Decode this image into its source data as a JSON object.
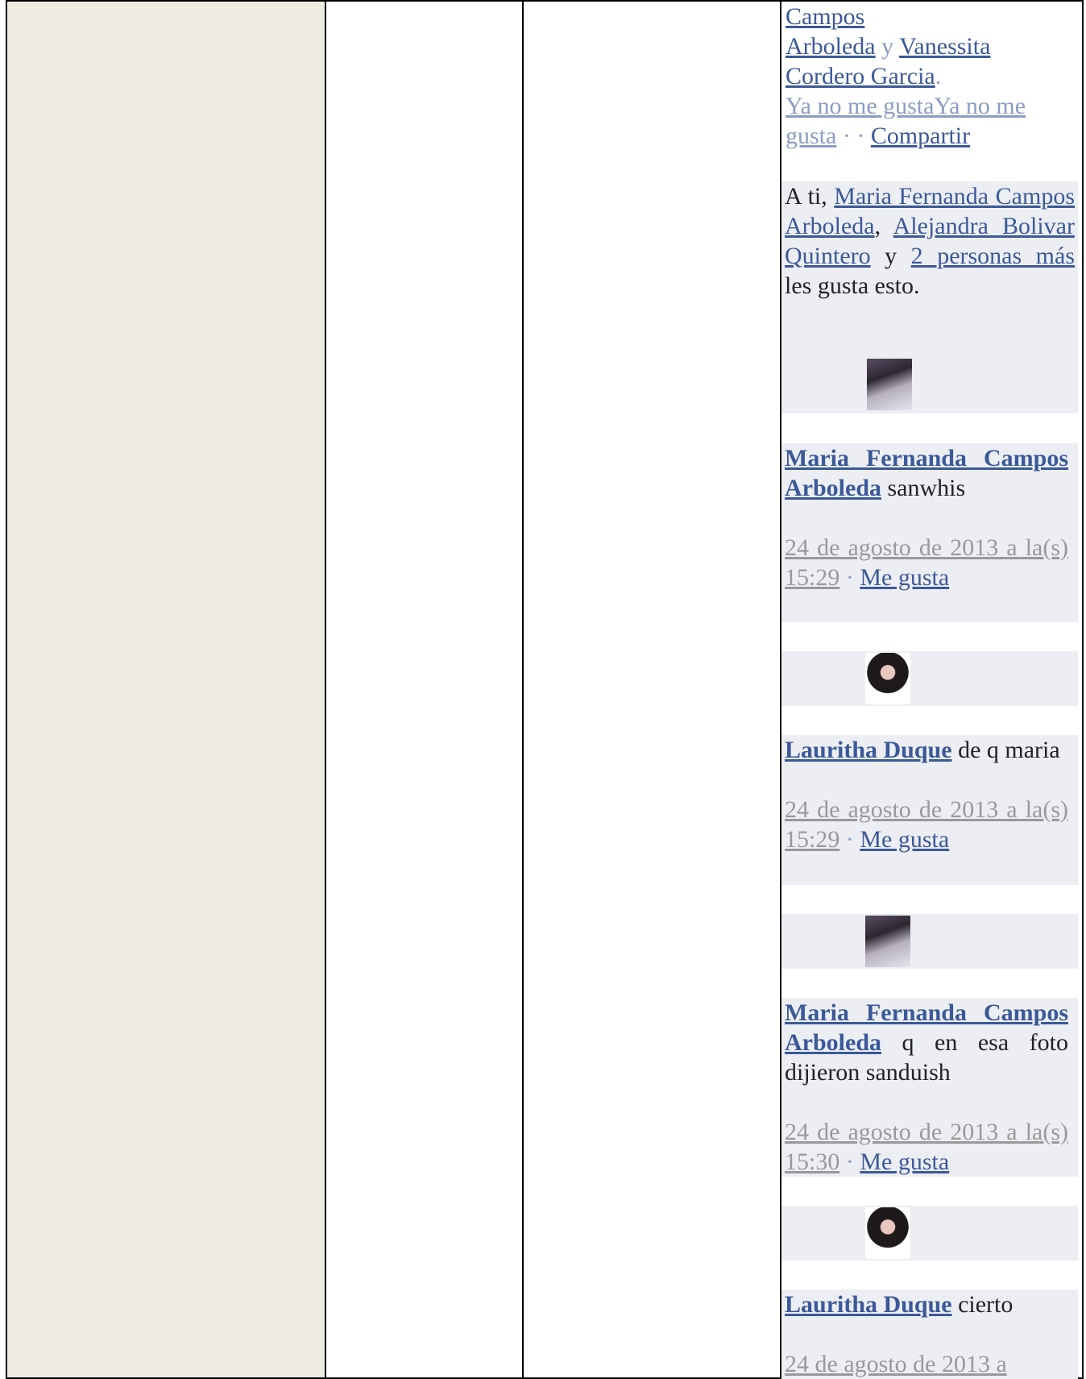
{
  "top_block": {
    "line1": "Campos",
    "name_a": "Arboleda",
    "and_word": "y",
    "name_b1": "Vanessita",
    "name_b2": "Cordero Garcia",
    "period": ".",
    "unlike1": "Ya no me gustaYa no me",
    "unlike2": "gusta",
    "sep": "· ·",
    "share": "Compartir"
  },
  "likes_box": {
    "pre": "A ti,",
    "p1": "Maria Fernanda Campos Arboleda",
    "comma": ",",
    "p2": "Alejandra Bolivar Quintero",
    "y": "y",
    "more": "2 personas más",
    "post": "les gusta esto."
  },
  "comments": [
    {
      "author": "Maria Fernanda Campos Arboleda",
      "text": "sanwhis",
      "time": "24 de agosto de 2013 a la(s) 15:29",
      "like": "Me gusta",
      "avatar": "avatar-dark-photo"
    },
    {
      "author": "Lauritha Duque",
      "text": "de q maria",
      "time": "24 de agosto de 2013 a la(s) 15:29",
      "like": "Me gusta",
      "avatar": "avatar-portrait"
    },
    {
      "author": "Maria Fernanda Campos Arboleda",
      "text": "q en esa foto dijieron sanduish",
      "time": "24 de agosto de 2013 a la(s) 15:30",
      "like": "Me gusta",
      "avatar": "avatar-dark-photo"
    },
    {
      "author": "Lauritha Duque",
      "text": "cierto",
      "time": "24 de agosto de 2013 a",
      "like": "",
      "avatar": "avatar-portrait"
    }
  ],
  "separator": "·"
}
